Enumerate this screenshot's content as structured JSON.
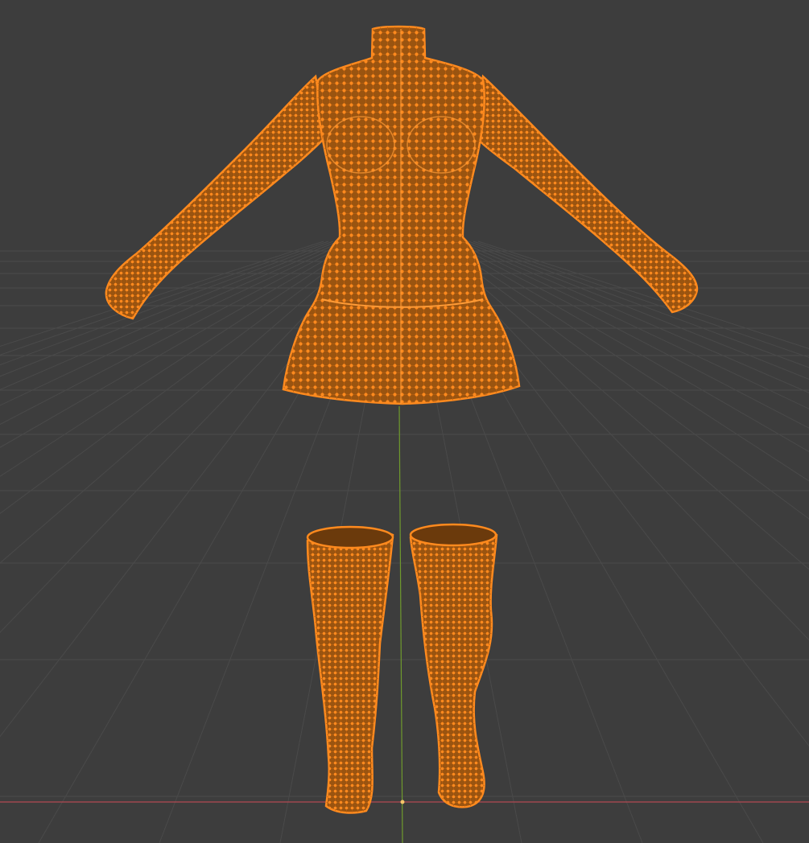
{
  "viewport": {
    "mode": "edit-mode-vertex-select",
    "background_color": "#3d3d3d",
    "grid_color": "#4a4a4a",
    "x_axis_color": "#b34952",
    "y_axis_color": "#6f9a2d",
    "selection_color": "#ff8a1e",
    "origin_color": "#f5c46a"
  },
  "objects": [
    {
      "name": "dress-mesh",
      "selected": true
    },
    {
      "name": "left-stocking-mesh",
      "selected": true
    },
    {
      "name": "right-stocking-mesh",
      "selected": true
    }
  ]
}
